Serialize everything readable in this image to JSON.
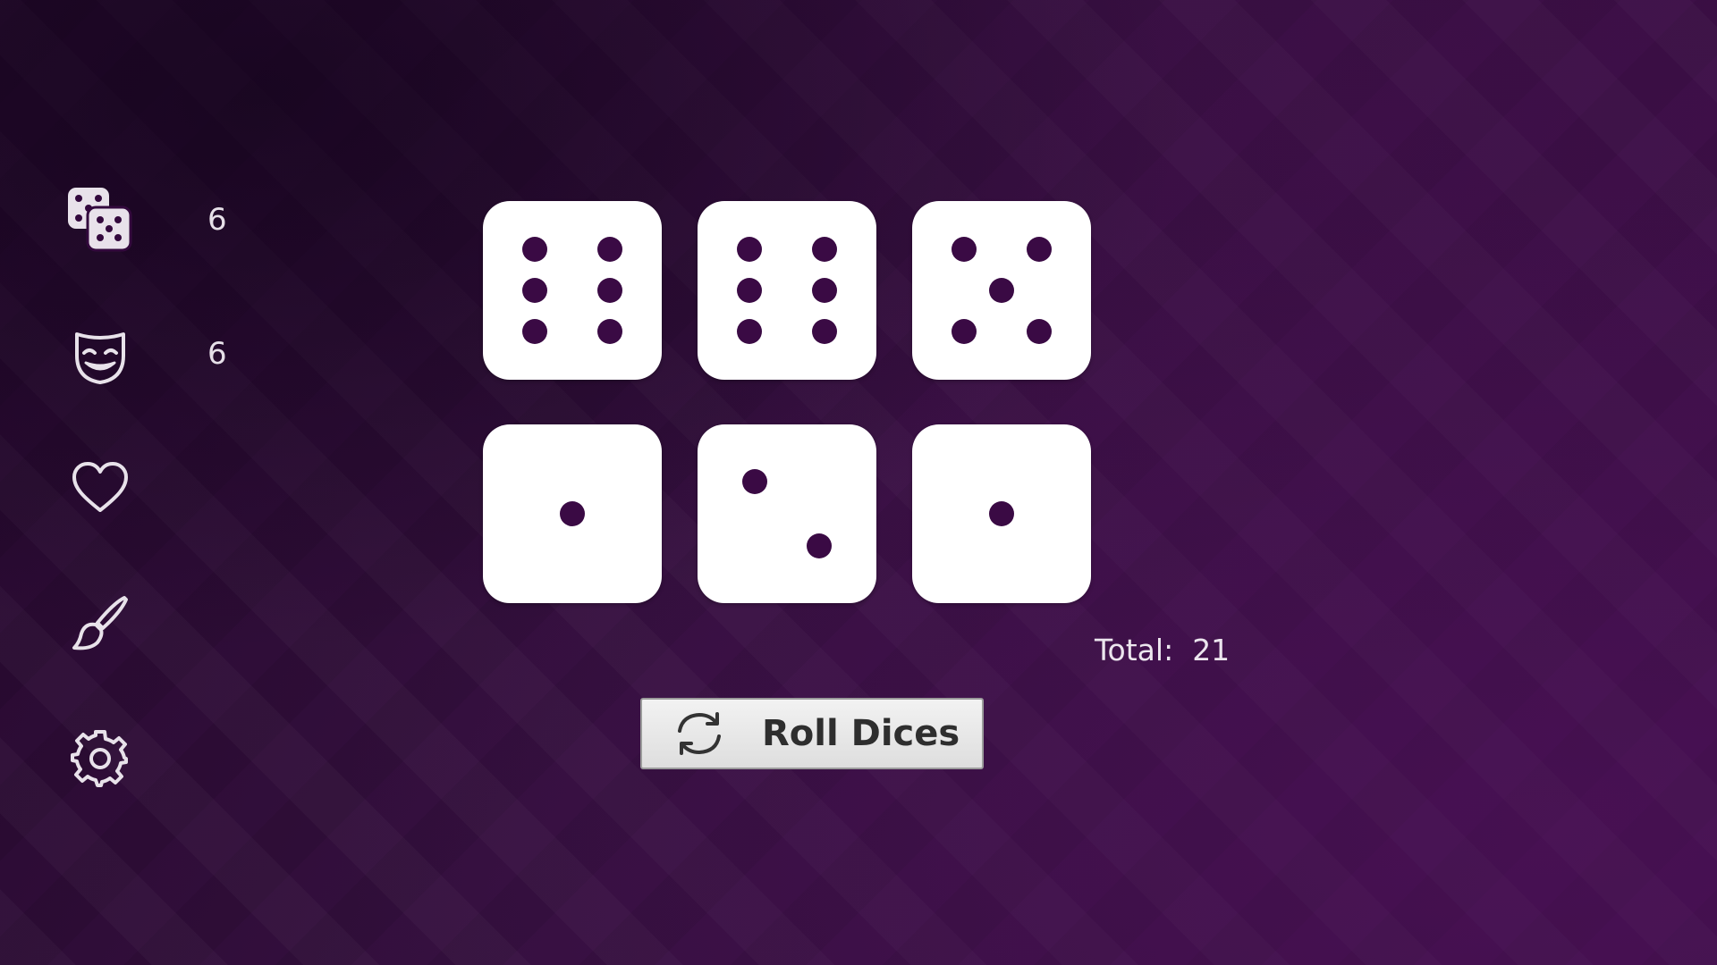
{
  "sidebar": {
    "items": [
      {
        "name": "dice",
        "icon": "dice-icon",
        "count": "6"
      },
      {
        "name": "theater",
        "icon": "theater-mask-icon",
        "count": "6"
      },
      {
        "name": "favorites",
        "icon": "heart-icon"
      },
      {
        "name": "theme",
        "icon": "paint-brush-icon"
      },
      {
        "name": "settings",
        "icon": "gear-icon"
      }
    ]
  },
  "dice": [
    {
      "value": 6
    },
    {
      "value": 6
    },
    {
      "value": 5
    },
    {
      "value": 1
    },
    {
      "value": 2
    },
    {
      "value": 1
    }
  ],
  "total": {
    "label": "Total:",
    "value": "21"
  },
  "roll_button": {
    "label": "Roll Dices",
    "icon": "refresh-icon"
  },
  "colors": {
    "background": "#330b3c",
    "die_face": "#ffffff",
    "pip": "#3a0a44",
    "icon": "#e8e2ea"
  }
}
